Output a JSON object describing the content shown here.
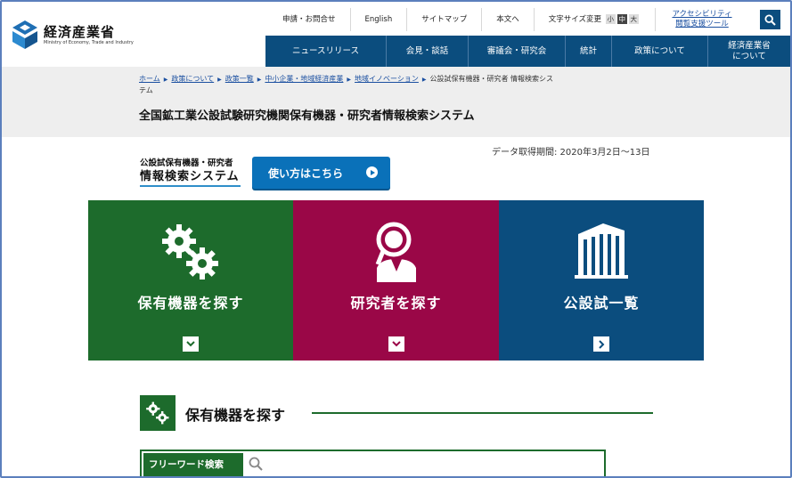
{
  "header": {
    "logo_ja": "経済産業省",
    "logo_en": "Ministry of Economy, Trade and Industry",
    "util_links": [
      "申請・お問合せ",
      "English",
      "サイトマップ",
      "本文へ"
    ],
    "font_size": {
      "label": "文字サイズ変更",
      "small": "小",
      "medium": "中",
      "large": "大"
    },
    "accessibility_line1": "アクセシビリティ",
    "accessibility_line2": "閲覧支援ツール",
    "search_icon": "search-icon",
    "nav": [
      "ニュースリリース",
      "会見・談話",
      "審議会・研究会",
      "統計",
      "政策について",
      "経済産業省\nについて"
    ]
  },
  "breadcrumb": {
    "links": [
      "ホーム",
      "政策について",
      "政策一覧",
      "中小企業・地域経済産業",
      "地域イノベーション"
    ],
    "current": "公設試保有機器・研究者 情報検索システム"
  },
  "page_title": "全国鉱工業公設試験研究機関保有機器・研究者情報検索システム",
  "data_period": "データ取得期間: 2020年3月2日～13日",
  "system_logo": {
    "line1": "公設試保有機器・研究者",
    "line2": "情報検索システム"
  },
  "howto_button": "使い方はこちら",
  "tiles": [
    {
      "label": "保有機器を探す",
      "icon": "gears-icon",
      "color": "#1d6b2c"
    },
    {
      "label": "研究者を探す",
      "icon": "researcher-icon",
      "color": "#9a0747"
    },
    {
      "label": "公設試一覧",
      "icon": "building-icon",
      "color": "#0b4d7e"
    }
  ],
  "section": {
    "title": "保有機器を探す",
    "icon": "gears-icon"
  },
  "freeword": {
    "label": "フリーワード検索",
    "icon": "search-icon"
  },
  "colors": {
    "navy": "#0b4d7e",
    "green": "#1d6b2c",
    "magenta": "#9a0747",
    "button_blue": "#0a71b9"
  }
}
